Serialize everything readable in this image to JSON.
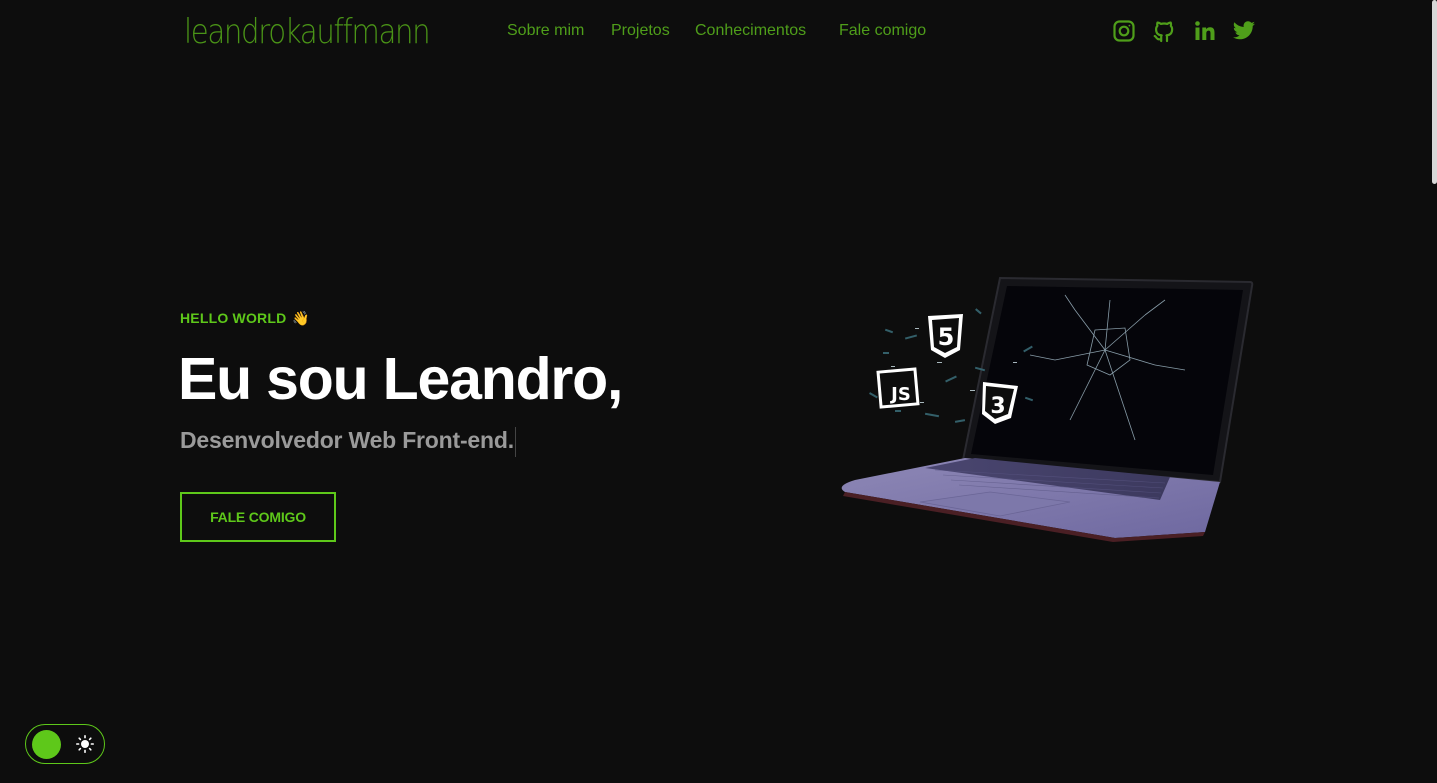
{
  "header": {
    "logo": "leandrokauffmann",
    "nav": [
      {
        "label": "Sobre mim"
      },
      {
        "label": "Projetos"
      },
      {
        "label": "Conhecimentos"
      },
      {
        "label": "Fale comigo"
      }
    ],
    "social_icons": [
      "instagram-icon",
      "github-icon",
      "linkedin-icon",
      "twitter-icon"
    ]
  },
  "hero": {
    "eyebrow": "HELLO WORLD",
    "eyebrow_emoji": "👋",
    "headline": "Eu sou Leandro,",
    "subtitle": "Desenvolvedor Web Front-end.",
    "cta_label": "FALE COMIGO",
    "badges": [
      "5",
      "JS",
      "3"
    ]
  },
  "theme_toggle": {
    "state": "dark",
    "icon": "sun-icon"
  },
  "colors": {
    "background": "#0d0d0d",
    "accent": "#5ec81a",
    "nav_text": "#4f9e1a",
    "headline": "#ffffff",
    "subtitle": "#9a9a9a"
  }
}
